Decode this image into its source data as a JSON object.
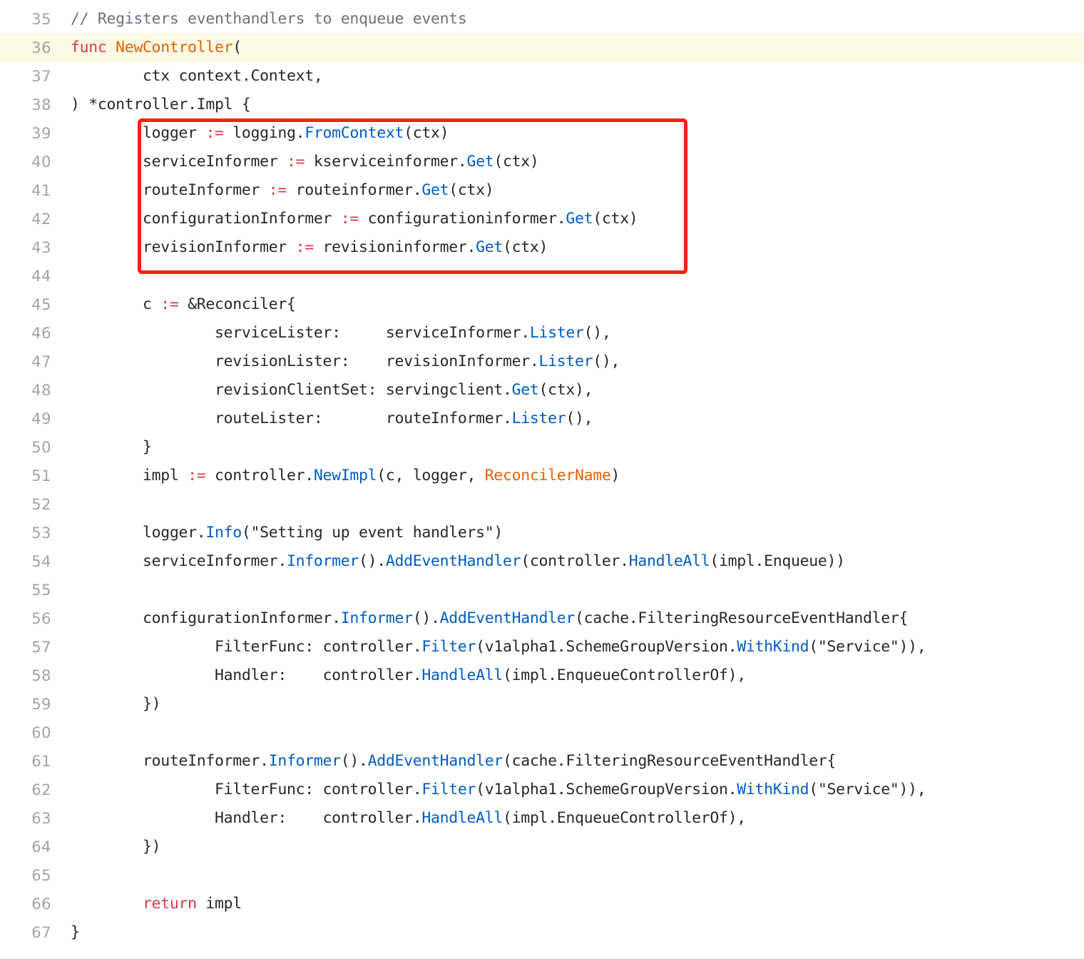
{
  "editor": {
    "language": "go",
    "first_line_number": 35,
    "last_line_number": 67,
    "highlighted_line": 36,
    "colors": {
      "background": "#ffffff",
      "text": "#24292e",
      "line_number": "#a0a4a8",
      "comment": "#6a737d",
      "keyword": "#d73a49",
      "function_name": "#e36209",
      "call": "#005cc5",
      "operator": "#d73a49",
      "highlight_row": "#fdfae5",
      "annotation_border": "#f42314"
    }
  },
  "annotation": {
    "type": "rectangle",
    "color": "#f42314",
    "covers_lines": [
      39,
      40,
      41,
      42,
      43
    ]
  },
  "lines": [
    {
      "num": "35",
      "highlight": false,
      "tokens": [
        {
          "text": "// Registers eventhandlers to enqueue events",
          "cls": "t-com"
        }
      ]
    },
    {
      "num": "36",
      "highlight": true,
      "tokens": [
        {
          "text": "func ",
          "cls": "t-kw"
        },
        {
          "text": "NewController",
          "cls": "t-fn"
        },
        {
          "text": "(",
          "cls": "t-plain"
        }
      ]
    },
    {
      "num": "37",
      "highlight": false,
      "tokens": [
        {
          "text": "        ctx context.Context,",
          "cls": "t-plain"
        }
      ]
    },
    {
      "num": "38",
      "highlight": false,
      "tokens": [
        {
          "text": ") *controller.Impl {",
          "cls": "t-plain"
        }
      ]
    },
    {
      "num": "39",
      "highlight": false,
      "tokens": [
        {
          "text": "        logger ",
          "cls": "t-plain"
        },
        {
          "text": ":=",
          "cls": "t-op"
        },
        {
          "text": " logging.",
          "cls": "t-plain"
        },
        {
          "text": "FromContext",
          "cls": "t-call"
        },
        {
          "text": "(ctx)",
          "cls": "t-plain"
        }
      ]
    },
    {
      "num": "40",
      "highlight": false,
      "tokens": [
        {
          "text": "        serviceInformer ",
          "cls": "t-plain"
        },
        {
          "text": ":=",
          "cls": "t-op"
        },
        {
          "text": " kserviceinformer.",
          "cls": "t-plain"
        },
        {
          "text": "Get",
          "cls": "t-call"
        },
        {
          "text": "(ctx)",
          "cls": "t-plain"
        }
      ]
    },
    {
      "num": "41",
      "highlight": false,
      "tokens": [
        {
          "text": "        routeInformer ",
          "cls": "t-plain"
        },
        {
          "text": ":=",
          "cls": "t-op"
        },
        {
          "text": " routeinformer.",
          "cls": "t-plain"
        },
        {
          "text": "Get",
          "cls": "t-call"
        },
        {
          "text": "(ctx)",
          "cls": "t-plain"
        }
      ]
    },
    {
      "num": "42",
      "highlight": false,
      "tokens": [
        {
          "text": "        configurationInformer ",
          "cls": "t-plain"
        },
        {
          "text": ":=",
          "cls": "t-op"
        },
        {
          "text": " configurationinformer.",
          "cls": "t-plain"
        },
        {
          "text": "Get",
          "cls": "t-call"
        },
        {
          "text": "(ctx)",
          "cls": "t-plain"
        }
      ]
    },
    {
      "num": "43",
      "highlight": false,
      "tokens": [
        {
          "text": "        revisionInformer ",
          "cls": "t-plain"
        },
        {
          "text": ":=",
          "cls": "t-op"
        },
        {
          "text": " revisioninformer.",
          "cls": "t-plain"
        },
        {
          "text": "Get",
          "cls": "t-call"
        },
        {
          "text": "(ctx)",
          "cls": "t-plain"
        }
      ]
    },
    {
      "num": "44",
      "highlight": false,
      "tokens": []
    },
    {
      "num": "45",
      "highlight": false,
      "tokens": [
        {
          "text": "        c ",
          "cls": "t-plain"
        },
        {
          "text": ":=",
          "cls": "t-op"
        },
        {
          "text": " &Reconciler{",
          "cls": "t-plain"
        }
      ]
    },
    {
      "num": "46",
      "highlight": false,
      "tokens": [
        {
          "text": "                serviceLister:     serviceInformer.",
          "cls": "t-plain"
        },
        {
          "text": "Lister",
          "cls": "t-call"
        },
        {
          "text": "(),",
          "cls": "t-plain"
        }
      ]
    },
    {
      "num": "47",
      "highlight": false,
      "tokens": [
        {
          "text": "                revisionLister:    revisionInformer.",
          "cls": "t-plain"
        },
        {
          "text": "Lister",
          "cls": "t-call"
        },
        {
          "text": "(),",
          "cls": "t-plain"
        }
      ]
    },
    {
      "num": "48",
      "highlight": false,
      "tokens": [
        {
          "text": "                revisionClientSet: servingclient.",
          "cls": "t-plain"
        },
        {
          "text": "Get",
          "cls": "t-call"
        },
        {
          "text": "(ctx),",
          "cls": "t-plain"
        }
      ]
    },
    {
      "num": "49",
      "highlight": false,
      "tokens": [
        {
          "text": "                routeLister:       routeInformer.",
          "cls": "t-plain"
        },
        {
          "text": "Lister",
          "cls": "t-call"
        },
        {
          "text": "(),",
          "cls": "t-plain"
        }
      ]
    },
    {
      "num": "50",
      "highlight": false,
      "tokens": [
        {
          "text": "        }",
          "cls": "t-plain"
        }
      ]
    },
    {
      "num": "51",
      "highlight": false,
      "tokens": [
        {
          "text": "        impl ",
          "cls": "t-plain"
        },
        {
          "text": ":=",
          "cls": "t-op"
        },
        {
          "text": " controller.",
          "cls": "t-plain"
        },
        {
          "text": "NewImpl",
          "cls": "t-call"
        },
        {
          "text": "(c, logger, ",
          "cls": "t-plain"
        },
        {
          "text": "ReconcilerName",
          "cls": "t-fn"
        },
        {
          "text": ")",
          "cls": "t-plain"
        }
      ]
    },
    {
      "num": "52",
      "highlight": false,
      "tokens": []
    },
    {
      "num": "53",
      "highlight": false,
      "tokens": [
        {
          "text": "        logger.",
          "cls": "t-plain"
        },
        {
          "text": "Info",
          "cls": "t-call"
        },
        {
          "text": "(\"Setting up event handlers\")",
          "cls": "t-plain"
        }
      ]
    },
    {
      "num": "54",
      "highlight": false,
      "tokens": [
        {
          "text": "        serviceInformer.",
          "cls": "t-plain"
        },
        {
          "text": "Informer",
          "cls": "t-call"
        },
        {
          "text": "().",
          "cls": "t-plain"
        },
        {
          "text": "AddEventHandler",
          "cls": "t-call"
        },
        {
          "text": "(controller.",
          "cls": "t-plain"
        },
        {
          "text": "HandleAll",
          "cls": "t-call"
        },
        {
          "text": "(impl.Enqueue))",
          "cls": "t-plain"
        }
      ]
    },
    {
      "num": "55",
      "highlight": false,
      "tokens": []
    },
    {
      "num": "56",
      "highlight": false,
      "tokens": [
        {
          "text": "        configurationInformer.",
          "cls": "t-plain"
        },
        {
          "text": "Informer",
          "cls": "t-call"
        },
        {
          "text": "().",
          "cls": "t-plain"
        },
        {
          "text": "AddEventHandler",
          "cls": "t-call"
        },
        {
          "text": "(cache.FilteringResourceEventHandler{",
          "cls": "t-plain"
        }
      ]
    },
    {
      "num": "57",
      "highlight": false,
      "tokens": [
        {
          "text": "                FilterFunc: controller.",
          "cls": "t-plain"
        },
        {
          "text": "Filter",
          "cls": "t-call"
        },
        {
          "text": "(v1alpha1.SchemeGroupVersion.",
          "cls": "t-plain"
        },
        {
          "text": "WithKind",
          "cls": "t-call"
        },
        {
          "text": "(\"Service\")),",
          "cls": "t-plain"
        }
      ]
    },
    {
      "num": "58",
      "highlight": false,
      "tokens": [
        {
          "text": "                Handler:    controller.",
          "cls": "t-plain"
        },
        {
          "text": "HandleAll",
          "cls": "t-call"
        },
        {
          "text": "(impl.EnqueueControllerOf),",
          "cls": "t-plain"
        }
      ]
    },
    {
      "num": "59",
      "highlight": false,
      "tokens": [
        {
          "text": "        })",
          "cls": "t-plain"
        }
      ]
    },
    {
      "num": "60",
      "highlight": false,
      "tokens": []
    },
    {
      "num": "61",
      "highlight": false,
      "tokens": [
        {
          "text": "        routeInformer.",
          "cls": "t-plain"
        },
        {
          "text": "Informer",
          "cls": "t-call"
        },
        {
          "text": "().",
          "cls": "t-plain"
        },
        {
          "text": "AddEventHandler",
          "cls": "t-call"
        },
        {
          "text": "(cache.FilteringResourceEventHandler{",
          "cls": "t-plain"
        }
      ]
    },
    {
      "num": "62",
      "highlight": false,
      "tokens": [
        {
          "text": "                FilterFunc: controller.",
          "cls": "t-plain"
        },
        {
          "text": "Filter",
          "cls": "t-call"
        },
        {
          "text": "(v1alpha1.SchemeGroupVersion.",
          "cls": "t-plain"
        },
        {
          "text": "WithKind",
          "cls": "t-call"
        },
        {
          "text": "(\"Service\")),",
          "cls": "t-plain"
        }
      ]
    },
    {
      "num": "63",
      "highlight": false,
      "tokens": [
        {
          "text": "                Handler:    controller.",
          "cls": "t-plain"
        },
        {
          "text": "HandleAll",
          "cls": "t-call"
        },
        {
          "text": "(impl.EnqueueControllerOf),",
          "cls": "t-plain"
        }
      ]
    },
    {
      "num": "64",
      "highlight": false,
      "tokens": [
        {
          "text": "        })",
          "cls": "t-plain"
        }
      ]
    },
    {
      "num": "65",
      "highlight": false,
      "tokens": []
    },
    {
      "num": "66",
      "highlight": false,
      "tokens": [
        {
          "text": "        ",
          "cls": "t-plain"
        },
        {
          "text": "return",
          "cls": "t-kw"
        },
        {
          "text": " impl",
          "cls": "t-plain"
        }
      ]
    },
    {
      "num": "67",
      "highlight": false,
      "tokens": [
        {
          "text": "}",
          "cls": "t-plain"
        }
      ]
    }
  ]
}
